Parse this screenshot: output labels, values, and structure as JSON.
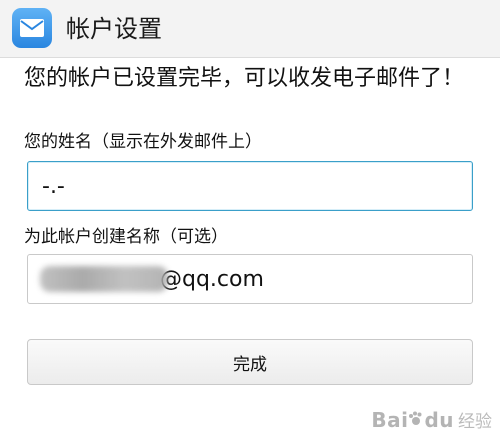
{
  "header": {
    "title": "帐户设置",
    "icon": "mail-icon",
    "icon_color": "#2a86e0"
  },
  "intro": {
    "message": "您的帐户已设置完毕，可以收发电子邮件了！"
  },
  "form": {
    "name_label": "您的姓名（显示在外发邮件上）",
    "name_value": "-.-",
    "account_label": "为此帐户创建名称（可选）",
    "account_value_visible": "@qq.com",
    "focus_color": "#3a9fc9"
  },
  "actions": {
    "done_label": "完成"
  },
  "watermark": {
    "logo": "Bai",
    "logo_suffix": "du",
    "sub": "经验"
  }
}
